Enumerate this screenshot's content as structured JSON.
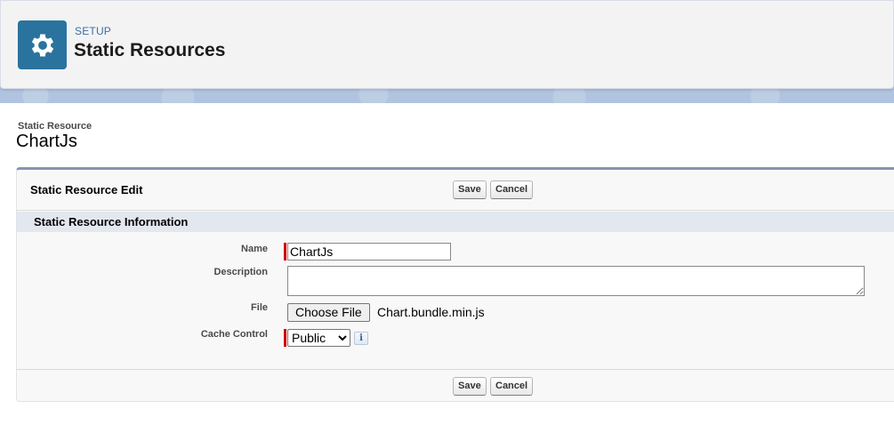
{
  "header": {
    "eyebrow": "SETUP",
    "title": "Static Resources",
    "icon": "gear-icon"
  },
  "record": {
    "object_label": "Static Resource",
    "name": "ChartJs"
  },
  "edit_block": {
    "title": "Static Resource Edit",
    "save_label": "Save",
    "cancel_label": "Cancel"
  },
  "section": {
    "title": "Static Resource Information"
  },
  "fields": {
    "name": {
      "label": "Name",
      "value": "ChartJs",
      "required": true
    },
    "description": {
      "label": "Description",
      "value": ""
    },
    "file": {
      "label": "File",
      "button_label": "Choose File",
      "file_name": "Chart.bundle.min.js"
    },
    "cache_control": {
      "label": "Cache Control",
      "selected": "Public",
      "options": [
        "Public"
      ],
      "required": true,
      "info_icon": "info-icon"
    }
  },
  "colors": {
    "brand_icon_bg": "#2a739e",
    "required_marker": "#cc0000",
    "section_header_bg": "#e3e7ef"
  }
}
